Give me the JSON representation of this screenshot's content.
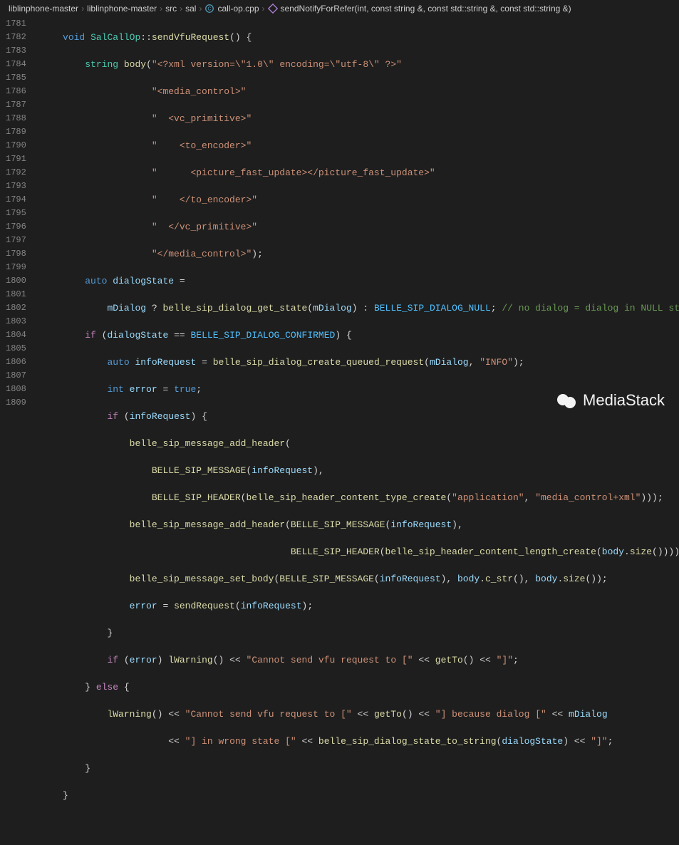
{
  "breadcrumb": {
    "items": [
      "liblinphone-master",
      "liblinphone-master",
      "src",
      "sal"
    ],
    "file": "call-op.cpp",
    "symbol": "sendNotifyForRefer(int, const string &, const std::string &, const std::string &)"
  },
  "lineStart": 1781,
  "lineEnd": 1809,
  "watermark": "MediaStack",
  "code": {
    "l1781": {
      "k1": "void",
      "t1": "SalCallOp",
      "f1": "sendVfuRequest",
      "p1": "::",
      "p2": "() {"
    },
    "l1782": {
      "t1": "string",
      "f1": "body",
      "s1": "\"<?xml version=\\\"1.0\\\" encoding=\\\"utf-8\\\" ?>\""
    },
    "l1783": {
      "s1": "\"<media_control>\""
    },
    "l1784": {
      "s1": "\"  <vc_primitive>\""
    },
    "l1785": {
      "s1": "\"    <to_encoder>\""
    },
    "l1786": {
      "s1": "\"      <picture_fast_update></picture_fast_update>\""
    },
    "l1787": {
      "s1": "\"    </to_encoder>\""
    },
    "l1788": {
      "s1": "\"  </vc_primitive>\""
    },
    "l1789": {
      "s1": "\"</media_control>\""
    },
    "l1790": {
      "k1": "auto",
      "v1": "dialogState",
      "op": "="
    },
    "l1791": {
      "v1": "mDialog",
      "f1": "belle_sip_dialog_get_state",
      "v2": "mDialog",
      "c1": "BELLE_SIP_DIALOG_NULL",
      "cm": "// no dialog = dialog in NULL state"
    },
    "l1792": {
      "k1": "if",
      "v1": "dialogState",
      "c1": "BELLE_SIP_DIALOG_CONFIRMED"
    },
    "l1793": {
      "k1": "auto",
      "v1": "infoRequest",
      "f1": "belle_sip_dialog_create_queued_request",
      "v2": "mDialog",
      "s1": "\"INFO\""
    },
    "l1794": {
      "k1": "int",
      "v1": "error",
      "k2": "true"
    },
    "l1795": {
      "k1": "if",
      "v1": "infoRequest"
    },
    "l1796": {
      "f1": "belle_sip_message_add_header"
    },
    "l1797": {
      "f1": "BELLE_SIP_MESSAGE",
      "v1": "infoRequest"
    },
    "l1798": {
      "f1": "BELLE_SIP_HEADER",
      "f2": "belle_sip_header_content_type_create",
      "s1": "\"application\"",
      "s2": "\"media_control+xml\""
    },
    "l1799": {
      "f1": "belle_sip_message_add_header",
      "f2": "BELLE_SIP_MESSAGE",
      "v1": "infoRequest"
    },
    "l1800": {
      "f1": "BELLE_SIP_HEADER",
      "f2": "belle_sip_header_content_length_create",
      "v1": "body",
      "f3": "size"
    },
    "l1801": {
      "f1": "belle_sip_message_set_body",
      "f2": "BELLE_SIP_MESSAGE",
      "v1": "infoRequest",
      "v2": "body",
      "f3": "c_str",
      "v3": "body",
      "f4": "size"
    },
    "l1802": {
      "v1": "error",
      "f1": "sendRequest",
      "v2": "infoRequest"
    },
    "l1803": {
      "p1": "}"
    },
    "l1804": {
      "k1": "if",
      "v1": "error",
      "f1": "lWarning",
      "s1": "\"Cannot send vfu request to [\"",
      "f2": "getTo",
      "s2": "\"]\""
    },
    "l1805": {
      "k1": "else"
    },
    "l1806": {
      "f1": "lWarning",
      "s1": "\"Cannot send vfu request to [\"",
      "f2": "getTo",
      "s2": "\"] because dialog [\"",
      "v1": "mDialog"
    },
    "l1807": {
      "s1": "\"] in wrong state [\"",
      "f1": "belle_sip_dialog_state_to_string",
      "v1": "dialogState",
      "s2": "\"]\""
    },
    "l1808": {
      "p1": "}"
    },
    "l1809": {
      "p1": "}"
    }
  }
}
